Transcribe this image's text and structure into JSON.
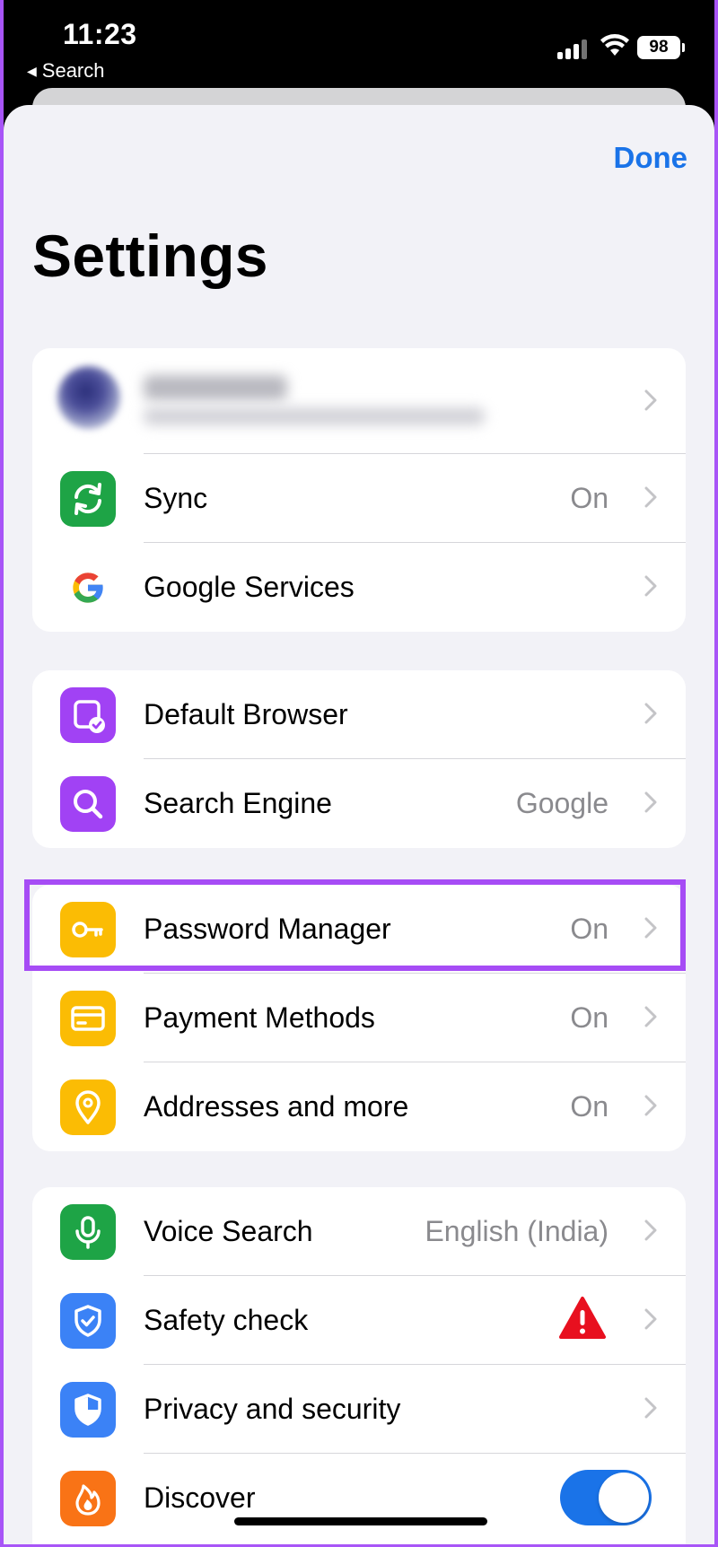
{
  "status_bar": {
    "time": "11:23",
    "back_label": "Search",
    "battery": "98"
  },
  "header": {
    "done_label": "Done",
    "title": "Settings"
  },
  "group1": {
    "sync": {
      "label": "Sync",
      "value": "On"
    },
    "google_services": {
      "label": "Google Services"
    }
  },
  "group2": {
    "default_browser": {
      "label": "Default Browser"
    },
    "search_engine": {
      "label": "Search Engine",
      "value": "Google"
    }
  },
  "group3": {
    "password_manager": {
      "label": "Password Manager",
      "value": "On"
    },
    "payment_methods": {
      "label": "Payment Methods",
      "value": "On"
    },
    "addresses": {
      "label": "Addresses and more",
      "value": "On"
    }
  },
  "group4": {
    "voice_search": {
      "label": "Voice Search",
      "value": "English (India)"
    },
    "safety_check": {
      "label": "Safety check"
    },
    "privacy": {
      "label": "Privacy and security"
    },
    "discover": {
      "label": "Discover",
      "enabled": true
    }
  },
  "colors": {
    "accent_blue": "#1a73e8",
    "highlight_purple": "#a64cf5",
    "green": "#1ea446",
    "purple": "#a142f4",
    "yellow": "#fbbc04",
    "blue": "#3b82f6",
    "orange": "#f97316",
    "warning_red": "#e8101f"
  },
  "icons": [
    "sync-icon",
    "google-g-icon",
    "default-browser-icon",
    "search-icon",
    "key-icon",
    "credit-card-icon",
    "location-pin-icon",
    "microphone-icon",
    "shield-check-icon",
    "shield-icon",
    "flame-icon",
    "warning-icon",
    "chevron-right-icon"
  ]
}
